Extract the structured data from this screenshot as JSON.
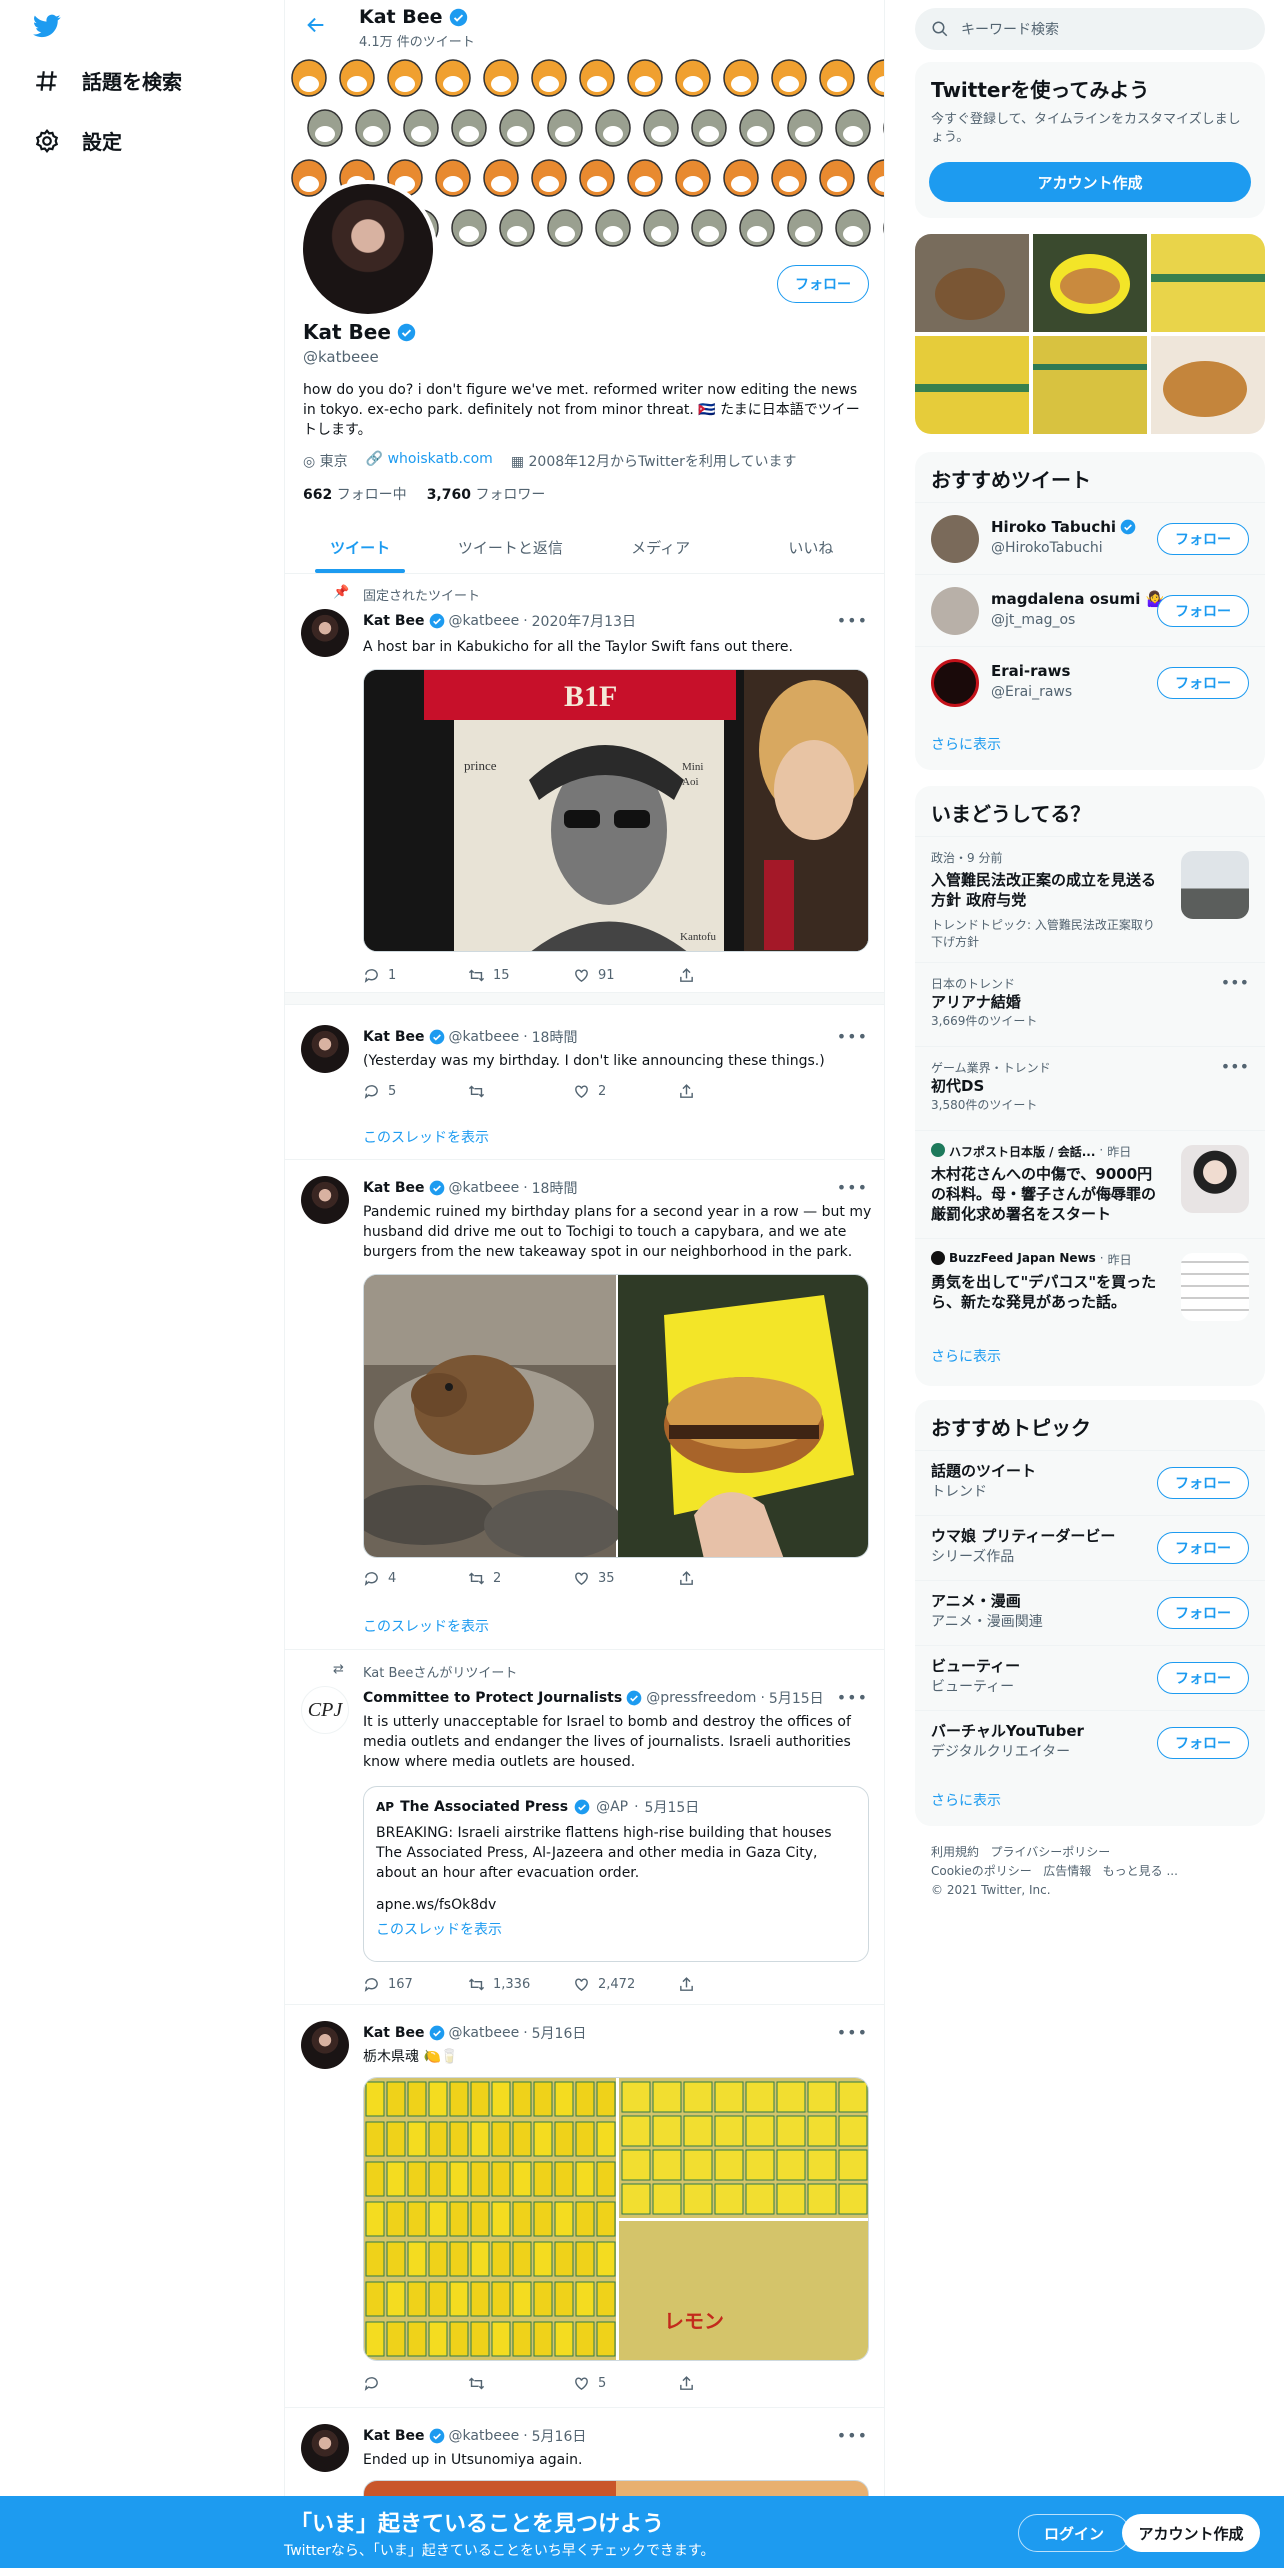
{
  "nav": {
    "explore": "話題を検索",
    "settings": "設定"
  },
  "profile": {
    "name": "Kat Bee",
    "tweet_count": "4.1万 件のツイート",
    "handle": "@katbeee",
    "follow_label": "フォロー",
    "bio": "how do you do? i don't figure we've met. reformed writer now editing the news in tokyo. ex-echo park. definitely not from minor threat. 🇨🇺 たまに日本語でツイートします。",
    "location": "東京",
    "website": "whoiskatb.com",
    "joined": "2008年12月からTwitterを利用しています",
    "following_count": "662",
    "following_label": "フォロー中",
    "followers_count": "3,760",
    "followers_label": "フォロワー"
  },
  "tabs": [
    "ツイート",
    "ツイートと返信",
    "メディア",
    "いいね"
  ],
  "tweets": [
    {
      "social": "固定されたツイート",
      "name": "Kat Bee",
      "handle": "@katbeee",
      "time": "2020年7月13日",
      "text": "A host bar in Kabukicho for all the Taylor Swift fans out there.",
      "replies": "1",
      "retweets": "15",
      "likes": "91",
      "media_text": [
        "B1F",
        "prince",
        "Mini",
        "Aoi",
        "Kantofu"
      ]
    },
    {
      "name": "Kat Bee",
      "handle": "@katbeee",
      "time": "18時間",
      "text": "(Yesterday was my birthday. I don't like announcing these things.)",
      "replies": "5",
      "retweets": "",
      "likes": "2",
      "show_thread": "このスレッドを表示"
    },
    {
      "name": "Kat Bee",
      "handle": "@katbeee",
      "time": "18時間",
      "text": "Pandemic ruined my birthday plans for a second year in a row — but my husband did drive me out to Tochigi to touch a capybara, and we ate burgers from the new takeaway spot in our neighborhood in the park.",
      "replies": "4",
      "retweets": "2",
      "likes": "35",
      "show_thread": "このスレッドを表示"
    },
    {
      "social": "Kat Beeさんがリツイート",
      "name": "Committee to Protect Journalists",
      "handle": "@pressfreedom",
      "time": "5月15日",
      "avatar_text": "CPJ",
      "text": "It is utterly unacceptable for Israel to bomb and destroy the offices of media outlets and endanger the lives of journalists. Israeli authorities know where media outlets are housed.",
      "replies": "167",
      "retweets": "1,336",
      "likes": "2,472",
      "quote": {
        "logo": "AP",
        "name": "The Associated Press",
        "handle": "@AP",
        "time": "5月15日",
        "text": "BREAKING: Israeli airstrike flattens high-rise building that houses The Associated Press, Al-Jazeera and other media in Gaza City, about an hour after evacuation order.",
        "link": "apne.ws/fsOk8dv",
        "show_thread": "このスレッドを表示"
      }
    },
    {
      "name": "Kat Bee",
      "handle": "@katbeee",
      "time": "5月16日",
      "text": "栃木県魂 🍋🥛",
      "replies": "",
      "retweets": "",
      "likes": "5",
      "media_text": "レモン"
    },
    {
      "name": "Kat Bee",
      "handle": "@katbeee",
      "time": "5月16日",
      "text": "Ended up in Utsunomiya again."
    }
  ],
  "right": {
    "search_placeholder": "キーワード検索",
    "signup_card": {
      "title": "Twitterを使ってみよう",
      "sub": "今すぐ登録して、タイムラインをカスタマイズしましょう。",
      "button": "アカウント作成"
    },
    "recommended": {
      "title": "おすすめツイート",
      "users": [
        {
          "name": "Hiroko Tabuchi",
          "handle": "@HirokoTabuchi",
          "verified": true,
          "color": "#7a6a5a"
        },
        {
          "name": "magdalena osumi 🤷‍♀️",
          "handle": "@jt_mag_os",
          "verified": false,
          "color": "#b8b0a8"
        },
        {
          "name": "Erai-raws",
          "handle": "@Erai_raws",
          "verified": false,
          "color": "#1a0a0a"
        }
      ],
      "follow": "フォロー",
      "more": "さらに表示"
    },
    "trends": {
      "title": "いまどうしてる？",
      "items": [
        {
          "meta": "政治・9 分前",
          "title": "入管難民法改正案の成立を見送る方針 政府与党",
          "sub": "トレンドトピック: 入管難民法改正案取り下げ方針"
        },
        {
          "meta": "日本のトレンド",
          "title": "アリアナ結婚",
          "count": "3,669件のツイート"
        },
        {
          "meta": "ゲーム業界・トレンド",
          "title": "初代DS",
          "count": "3,580件のツイート"
        },
        {
          "meta": "ハフポスト日本版 / 会話...",
          "time": "昨日",
          "title": "木村花さんへの中傷で、9000円の科料。母・響子さんが侮辱罪の厳罰化求め署名をスタート"
        },
        {
          "meta": "BuzzFeed Japan News",
          "time": "昨日",
          "title": "勇気を出して\"デパコス\"を買ったら、新たな発見があった話。"
        }
      ],
      "more": "さらに表示"
    },
    "topics": {
      "title": "おすすめトピック",
      "items": [
        {
          "title": "話題のツイート",
          "sub": "トレンド"
        },
        {
          "title": "ウマ娘 プリティーダービー",
          "sub": "シリーズ作品"
        },
        {
          "title": "アニメ・漫画",
          "sub": "アニメ・漫画関連"
        },
        {
          "title": "ビューティー",
          "sub": "ビューティー"
        },
        {
          "title": "バーチャルYouTuber",
          "sub": "デジタルクリエイター"
        }
      ],
      "follow": "フォロー",
      "more": "さらに表示"
    },
    "footer": {
      "terms": "利用規約",
      "privacy": "プライバシーポリシー",
      "cookie": "Cookieのポリシー",
      "ads": "広告情報",
      "more": "もっと見る ...",
      "copyright": "© 2021 Twitter, Inc."
    }
  },
  "bottom_bar": {
    "title": "「いま」起きていることを見つけよう",
    "sub": "Twitterなら、「いま」起きていることをいち早くチェックできます。",
    "login": "ログイン",
    "signup": "アカウント作成"
  },
  "colors": {
    "accent": "#1d9bf0",
    "text": "#0f1419",
    "secondary": "#536471"
  }
}
